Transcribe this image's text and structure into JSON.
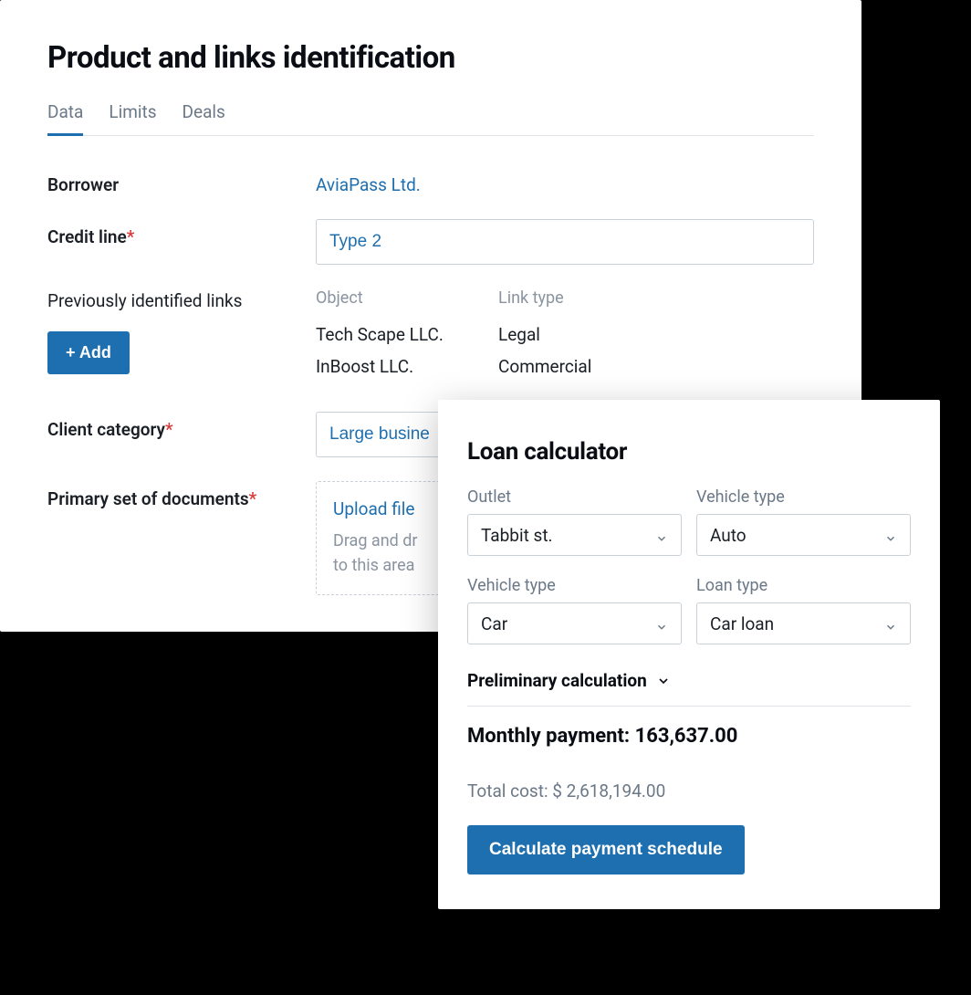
{
  "main": {
    "title": "Product and links identification",
    "tabs": [
      {
        "label": "Data",
        "active": true
      },
      {
        "label": "Limits",
        "active": false
      },
      {
        "label": "Deals",
        "active": false
      }
    ],
    "borrower": {
      "label": "Borrower",
      "value": "AviaPass Ltd."
    },
    "credit_line": {
      "label": "Credit line",
      "required": true,
      "value": "Type 2"
    },
    "prev_links": {
      "label": "Previously identified links",
      "add_button": "+ Add",
      "headers": {
        "object": "Object",
        "link_type": "Link type"
      },
      "rows": [
        {
          "object": "Tech Scape LLC.",
          "link_type": "Legal"
        },
        {
          "object": "InBoost LLC.",
          "link_type": "Commercial"
        }
      ]
    },
    "client_category": {
      "label": "Client category",
      "required": true,
      "value": "Large busine"
    },
    "documents": {
      "label": "Primary set of documents",
      "required": true,
      "upload_link": "Upload file",
      "hint_line1": "Drag and dr",
      "hint_line2": "to this area"
    }
  },
  "calc": {
    "title": "Loan calculator",
    "fields": {
      "outlet": {
        "label": "Outlet",
        "value": "Tabbit st."
      },
      "vehicle_type_1": {
        "label": "Vehicle type",
        "value": "Auto"
      },
      "vehicle_type_2": {
        "label": "Vehicle type",
        "value": "Car"
      },
      "loan_type": {
        "label": "Loan type",
        "value": "Car loan"
      }
    },
    "preliminary_label": "Preliminary calculation",
    "monthly_label": "Monthly payment:",
    "monthly_value": "163,637.00",
    "total_label": "Total cost:",
    "total_value": "$ 2,618,194.00",
    "button": "Calculate payment schedule"
  }
}
